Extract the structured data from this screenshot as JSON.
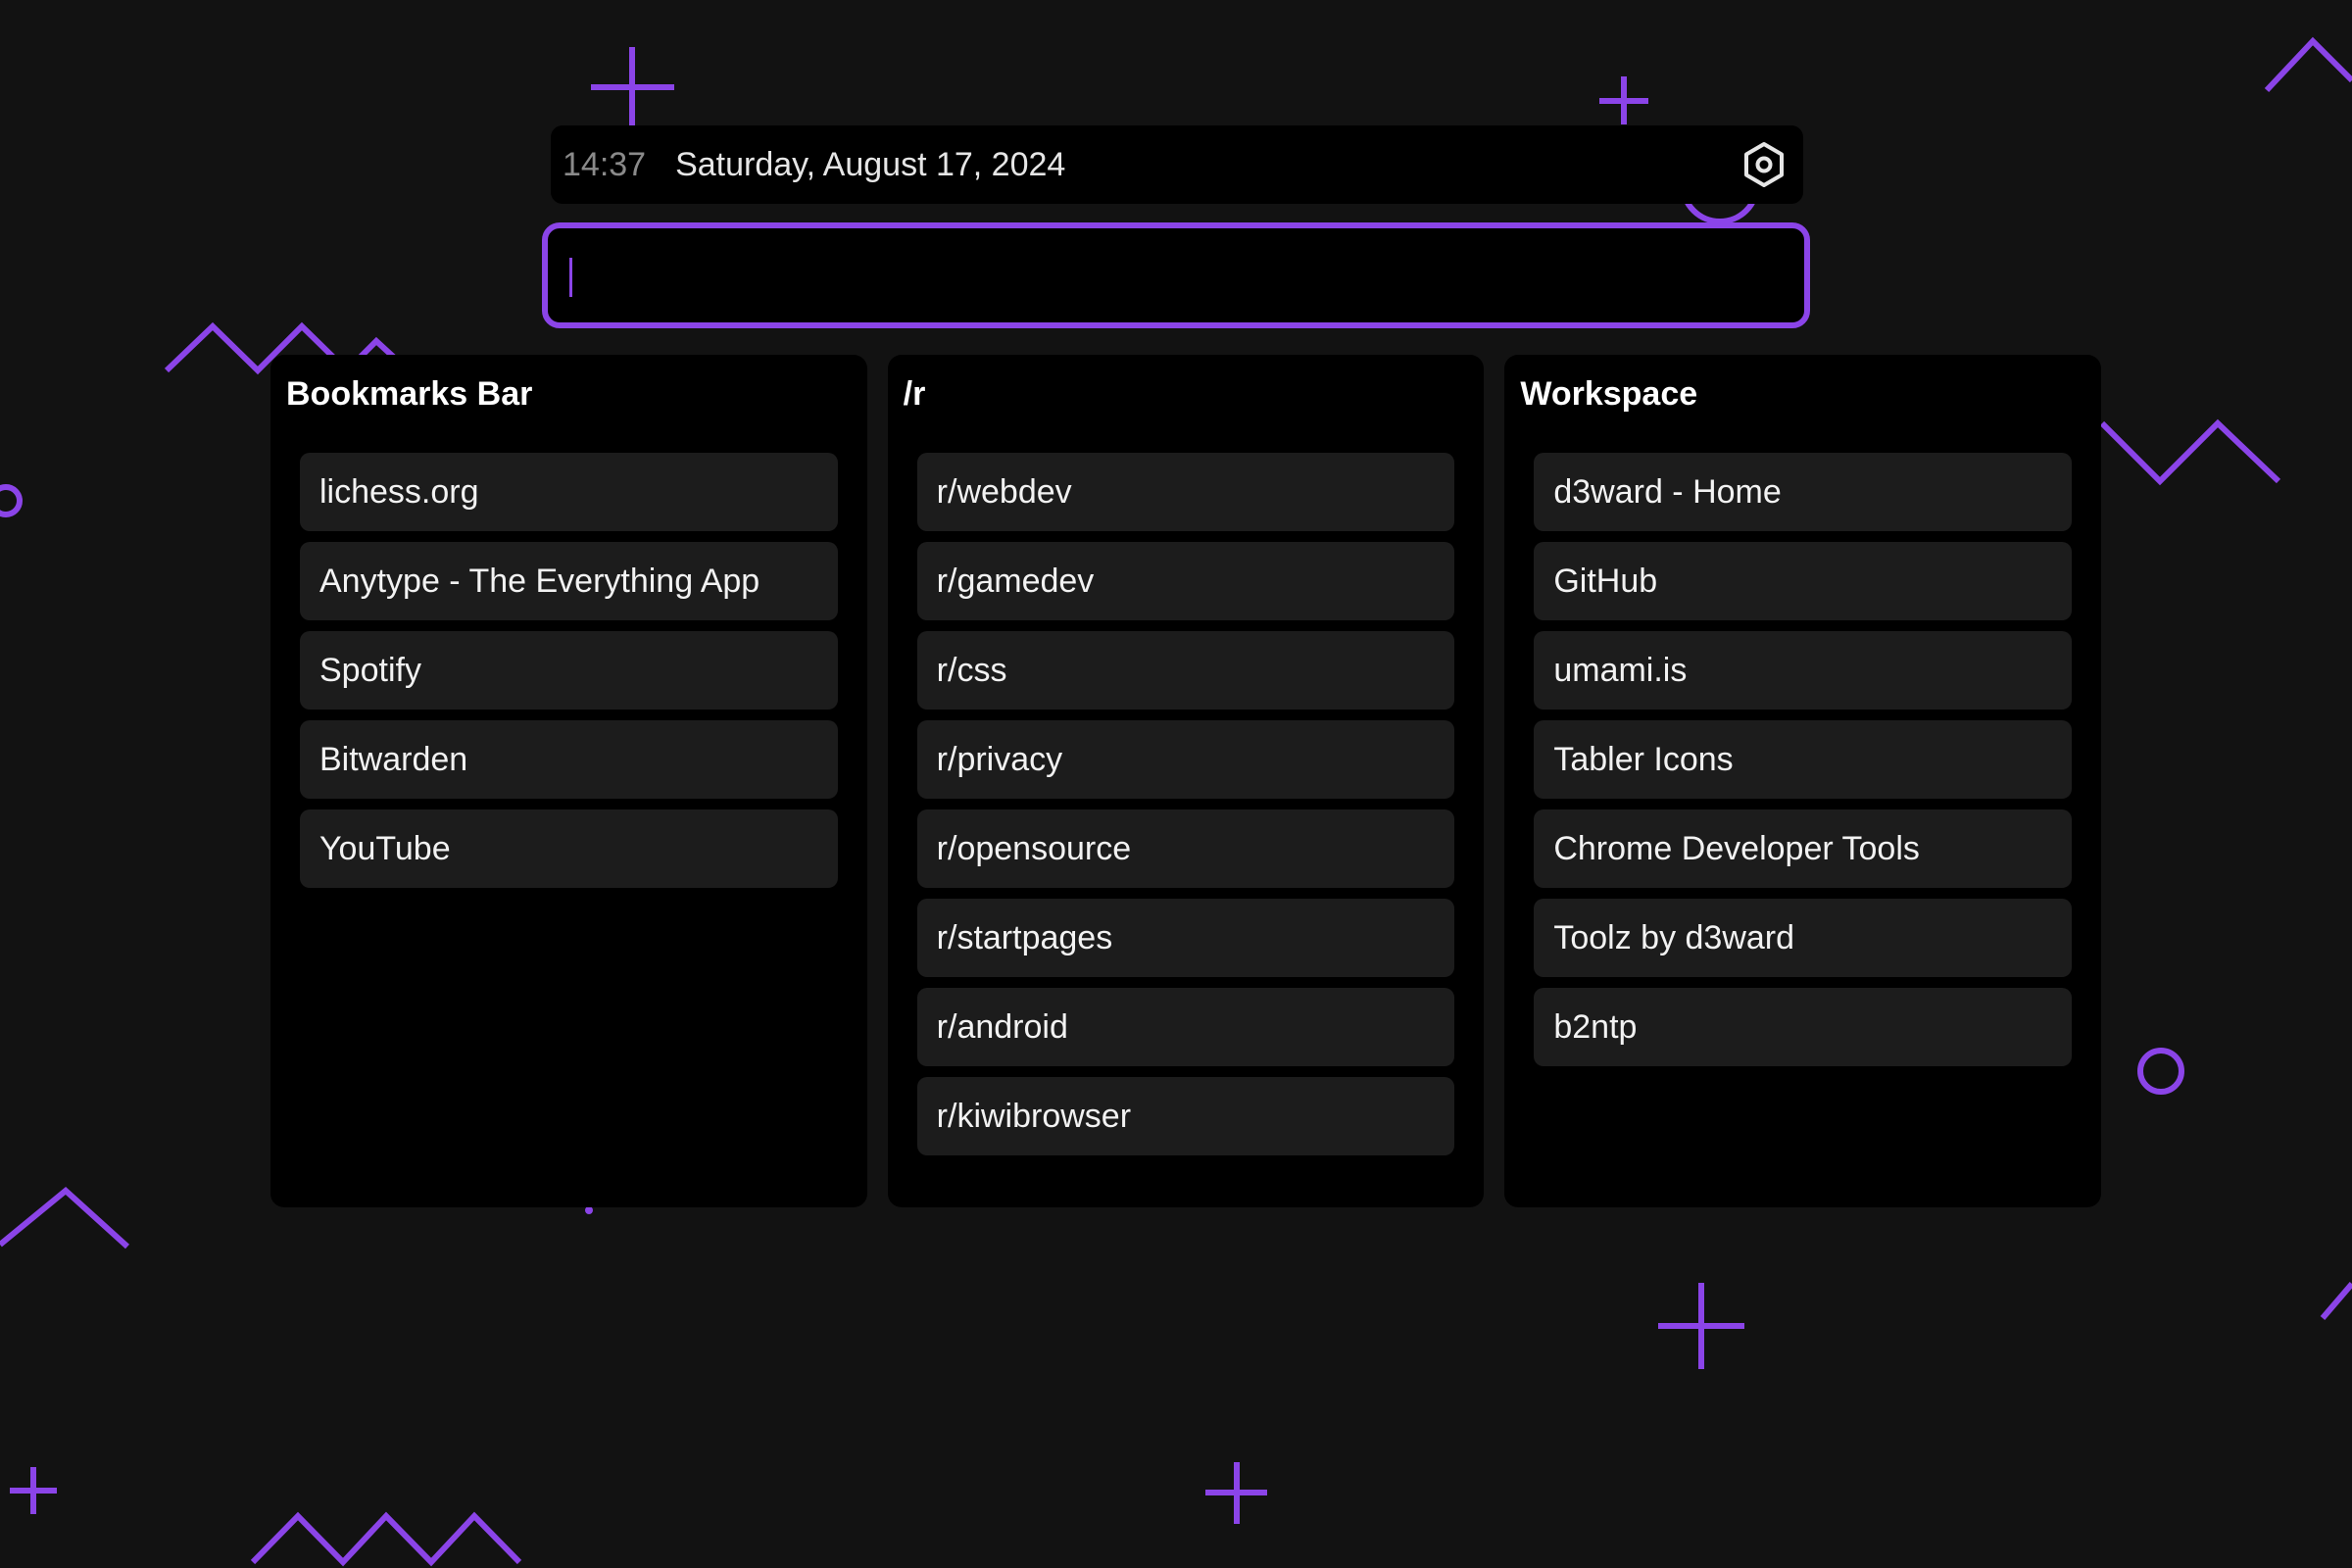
{
  "colors": {
    "background": "#121212",
    "panel": "#000000",
    "link_bg": "#1c1c1c",
    "accent": "#8b44e8"
  },
  "header": {
    "time": "14:37",
    "date": "Saturday, August 17, 2024",
    "settings_icon": "settings-hexagon-icon"
  },
  "search": {
    "value": "",
    "placeholder": ""
  },
  "columns": [
    {
      "title": "Bookmarks Bar",
      "links": [
        "lichess.org",
        "Anytype - The Everything App",
        "Spotify",
        "Bitwarden",
        "YouTube"
      ]
    },
    {
      "title": "/r",
      "links": [
        "r/webdev",
        "r/gamedev",
        "r/css",
        "r/privacy",
        "r/opensource",
        "r/startpages",
        "r/android",
        "r/kiwibrowser"
      ]
    },
    {
      "title": "Workspace",
      "links": [
        "d3ward - Home",
        "GitHub",
        "umami.is",
        "Tabler Icons",
        "Chrome Developer Tools",
        "Toolz by d3ward",
        "b2ntp"
      ]
    }
  ]
}
